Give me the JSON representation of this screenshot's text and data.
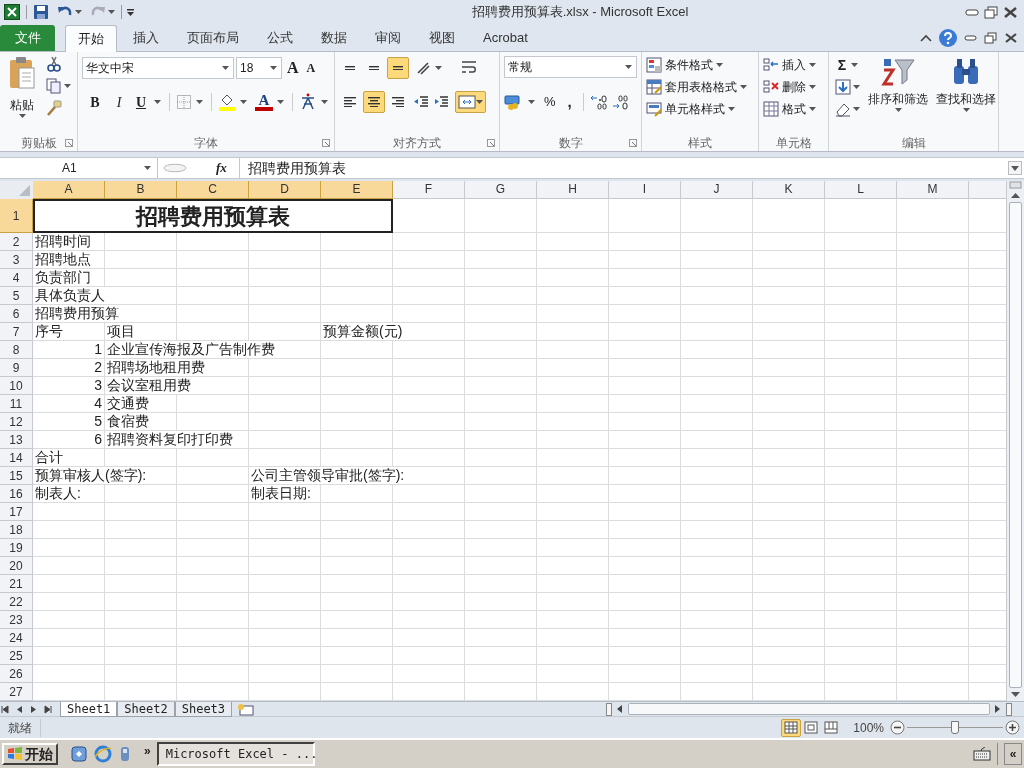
{
  "window": {
    "title": "招聘费用预算表.xlsx - Microsoft Excel"
  },
  "ribbon_tabs": [
    {
      "label": "文件",
      "kind": "file",
      "selected": false
    },
    {
      "label": "开始",
      "kind": "tab",
      "selected": true
    },
    {
      "label": "插入",
      "kind": "tab",
      "selected": false
    },
    {
      "label": "页面布局",
      "kind": "tab",
      "selected": false
    },
    {
      "label": "公式",
      "kind": "tab",
      "selected": false
    },
    {
      "label": "数据",
      "kind": "tab",
      "selected": false
    },
    {
      "label": "审阅",
      "kind": "tab",
      "selected": false
    },
    {
      "label": "视图",
      "kind": "tab",
      "selected": false
    },
    {
      "label": "Acrobat",
      "kind": "tab",
      "selected": false
    }
  ],
  "clipboard": {
    "paste": "粘贴",
    "label": "剪贴板"
  },
  "font": {
    "name": "华文中宋",
    "size": "18",
    "grow": "A",
    "shrink": "A",
    "bold": "B",
    "italic": "I",
    "underline": "U",
    "font_color_letter": "A",
    "label": "字体"
  },
  "alignment": {
    "vertical": [
      {
        "selected": false
      },
      {
        "selected": false
      },
      {
        "selected": true
      }
    ],
    "horizontal": [
      {
        "selected": false
      },
      {
        "selected": true
      },
      {
        "selected": false
      }
    ],
    "merge_selected": true,
    "label": "对齐方式"
  },
  "number": {
    "format": "常规",
    "percent": "%",
    "comma": ",",
    "label": "数字"
  },
  "styles": {
    "items": [
      "条件格式",
      "套用表格格式",
      "单元格样式"
    ],
    "label": "样式"
  },
  "cells_group": {
    "items": [
      "插入",
      "删除",
      "格式"
    ],
    "label": "单元格"
  },
  "editing": {
    "sum": "Σ",
    "sort": "排序和筛选",
    "find": "查找和选择",
    "label": "编辑"
  },
  "formula_bar": {
    "name_box": "A1",
    "fx": "fx",
    "content": "招聘费用预算表"
  },
  "sheet": {
    "columns": [
      {
        "label": "A",
        "selected": true
      },
      {
        "label": "B",
        "selected": true
      },
      {
        "label": "C",
        "selected": true
      },
      {
        "label": "D",
        "selected": true
      },
      {
        "label": "E",
        "selected": true
      },
      {
        "label": "F",
        "selected": false
      },
      {
        "label": "G",
        "selected": false
      },
      {
        "label": "H",
        "selected": false
      },
      {
        "label": "I",
        "selected": false
      },
      {
        "label": "J",
        "selected": false
      },
      {
        "label": "K",
        "selected": false
      },
      {
        "label": "L",
        "selected": false
      },
      {
        "label": "M",
        "selected": false
      }
    ],
    "rows": [
      {
        "number": "1",
        "kind": "title",
        "selected": true,
        "a": "招聘费用预算表"
      },
      {
        "number": "2",
        "kind": "plain",
        "selected": false,
        "a": "招聘时间"
      },
      {
        "number": "3",
        "kind": "plain",
        "selected": false,
        "a": "招聘地点"
      },
      {
        "number": "4",
        "kind": "plain",
        "selected": false,
        "a": "负责部门"
      },
      {
        "number": "5",
        "kind": "plain",
        "selected": false,
        "a": "具体负责人"
      },
      {
        "number": "6",
        "kind": "plain",
        "selected": false,
        "a": "招聘费用预算"
      },
      {
        "number": "7",
        "kind": "plain",
        "selected": false,
        "a": "序号",
        "b": "项目",
        "e": "预算金额(元)"
      },
      {
        "number": "8",
        "kind": "item",
        "selected": false,
        "a": "1",
        "b": "企业宣传海报及广告制作费"
      },
      {
        "number": "9",
        "kind": "item",
        "selected": false,
        "a": "2",
        "b": "招聘场地租用费"
      },
      {
        "number": "10",
        "kind": "item",
        "selected": false,
        "a": "3",
        "b": "会议室租用费"
      },
      {
        "number": "11",
        "kind": "item",
        "selected": false,
        "a": "4",
        "b": "交通费"
      },
      {
        "number": "12",
        "kind": "item",
        "selected": false,
        "a": "5",
        "b": "食宿费"
      },
      {
        "number": "13",
        "kind": "item",
        "selected": false,
        "a": "6",
        "b": "招聘资料复印打印费"
      },
      {
        "number": "14",
        "kind": "plain",
        "selected": false,
        "a": "合计"
      },
      {
        "number": "15",
        "kind": "plain",
        "selected": false,
        "a": "预算审核人(签字):",
        "d": "公司主管领导审批(签字):"
      },
      {
        "number": "16",
        "kind": "plain",
        "selected": false,
        "a": "制表人:",
        "d": "制表日期:"
      },
      {
        "number": "17",
        "kind": "plain",
        "selected": false
      },
      {
        "number": "18",
        "kind": "plain",
        "selected": false
      },
      {
        "number": "19",
        "kind": "plain",
        "selected": false
      },
      {
        "number": "20",
        "kind": "plain",
        "selected": false
      },
      {
        "number": "21",
        "kind": "plain",
        "selected": false
      },
      {
        "number": "22",
        "kind": "plain",
        "selected": false
      },
      {
        "number": "23",
        "kind": "plain",
        "selected": false
      },
      {
        "number": "24",
        "kind": "plain",
        "selected": false
      },
      {
        "number": "25",
        "kind": "plain",
        "selected": false
      },
      {
        "number": "26",
        "kind": "plain",
        "selected": false
      },
      {
        "number": "27",
        "kind": "plain",
        "selected": false
      }
    ]
  },
  "sheet_tabs": [
    {
      "label": "Sheet1",
      "selected": true
    },
    {
      "label": "Sheet2",
      "selected": false
    },
    {
      "label": "Sheet3",
      "selected": false
    }
  ],
  "status_bar": {
    "text": "就绪",
    "views": [
      {
        "selected": true
      },
      {
        "selected": false
      },
      {
        "selected": false
      }
    ],
    "zoom": "100%",
    "zoom_slider": {
      "level": 0.5
    }
  },
  "taskbar": {
    "start": "开始",
    "more": "»",
    "task": "Microsoft Excel - ...",
    "tray_more": "«"
  }
}
